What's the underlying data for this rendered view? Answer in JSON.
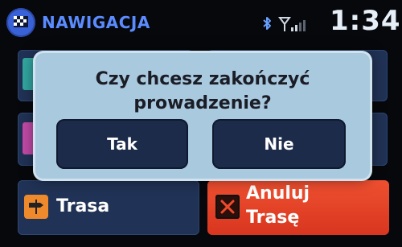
{
  "header": {
    "app_title": "NAWIGACJA",
    "time": "1:34",
    "icons": [
      "navigation-logo-icon",
      "bluetooth-icon",
      "signal-icon"
    ]
  },
  "tiles": {
    "route_label": "Trasa",
    "cancel_line1": "Anuluj",
    "cancel_line2": "Trasę"
  },
  "dialog": {
    "question_line1": "Czy chcesz zakończyć",
    "question_line2": "prowadzenie?",
    "yes_label": "Tak",
    "no_label": "Nie"
  },
  "colors": {
    "title": "#5b8cff",
    "dialog_bg": "#a9c9de",
    "button_bg": "#1c2b4a",
    "cancel_tile": "#e24326",
    "route_icon": "#ef8a2c"
  }
}
